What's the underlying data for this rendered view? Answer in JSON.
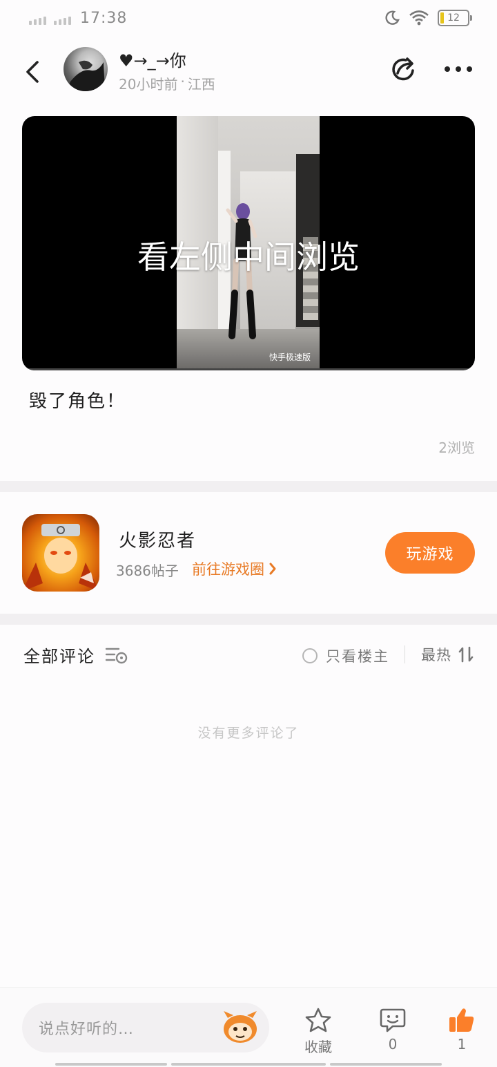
{
  "status_bar": {
    "time": "17:38",
    "battery": "12"
  },
  "header": {
    "user_name": "♥→_→你",
    "post_time": "20小时前",
    "location": "江西"
  },
  "video": {
    "overlay_text": "看左侧中间浏览",
    "watermark": "快手极速版"
  },
  "post": {
    "caption": "毁了角色！",
    "views": "2浏览"
  },
  "game": {
    "name": "火影忍者",
    "posts": "3686帖子",
    "link_label": "前往游戏圈",
    "play_label": "玩游戏"
  },
  "comments": {
    "title": "全部评论",
    "only_host_label": "只看楼主",
    "sort_label": "最热",
    "empty_text": "没有更多评论了"
  },
  "bottom_bar": {
    "input_placeholder": "说点好听的…",
    "favorite_label": "收藏",
    "comment_count": "0",
    "like_count": "1"
  },
  "colors": {
    "accent": "#fb7f2a",
    "link": "#e87a25",
    "battery": "#e6c41c"
  }
}
